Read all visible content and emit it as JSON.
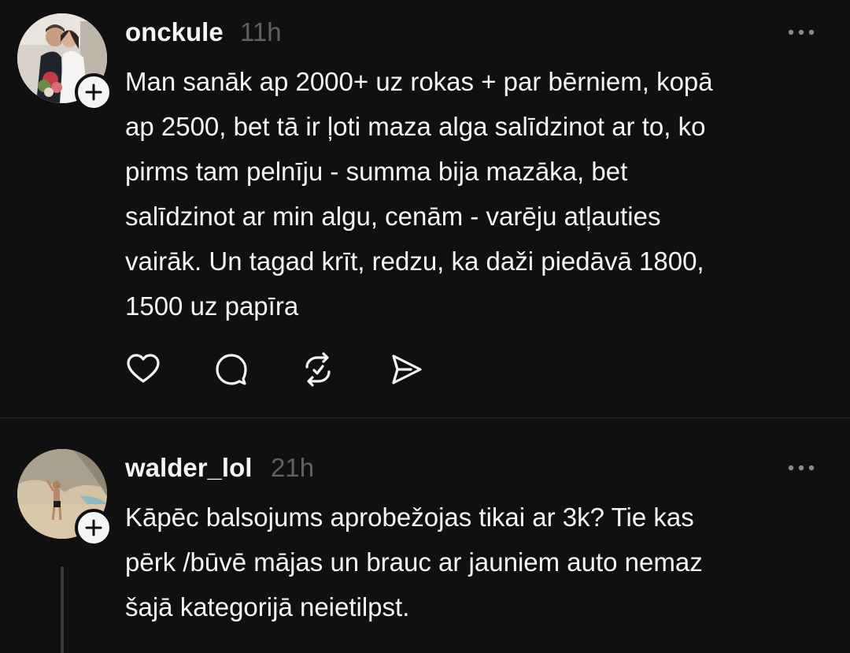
{
  "posts": [
    {
      "username": "onckule",
      "time": "11h",
      "text": "Man sanāk ap 2000+ uz rokas + par bērniem, kopā\nap 2500, bet tā ir ļoti maza alga salīdzinot ar to, ko\npirms tam pelnīju - summa bija mazāka, bet\nsalīdzinot ar min algu, cenām - varēju atļauties\nvairāk. Un tagad krīt, redzu, ka daži piedāvā 1800,\n1500 uz papīra",
      "actions": [
        "heart-icon",
        "comment-icon",
        "repost-icon",
        "share-icon"
      ]
    },
    {
      "username": "walder_lol",
      "time": "21h",
      "text": "Kāpēc balsojums aprobežojas tikai ar 3k? Tie kas\npērk /būvē mājas un brauc ar jauniem auto nemaz\nšajā kategorijā neietilpst."
    }
  ],
  "colors": {
    "background": "#101010",
    "text": "#f3f5f7",
    "muted": "#616161",
    "divider": "#2c2c2c"
  }
}
